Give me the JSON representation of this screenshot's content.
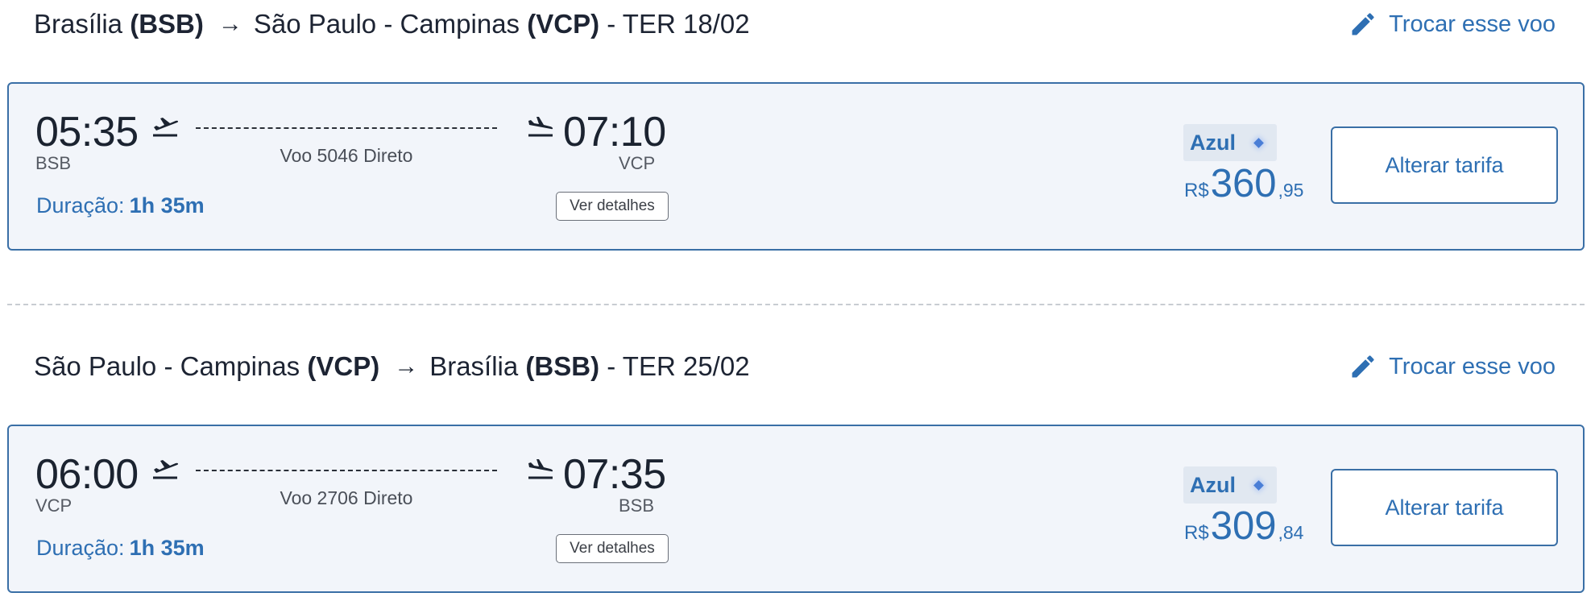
{
  "legs": [
    {
      "header": {
        "origin_city": "Brasília",
        "origin_code": "(BSB)",
        "dest_city": "São Paulo - Campinas",
        "dest_code": "(VCP)",
        "date": "- TER 18/02"
      },
      "change_label": "Trocar esse voo",
      "departure_time": "05:35",
      "departure_airport": "BSB",
      "arrival_time": "07:10",
      "arrival_airport": "VCP",
      "flight_info": "Voo 5046 Direto",
      "duration_label": "Duração:",
      "duration_value": "1h 35m",
      "details_label": "Ver detalhes",
      "airline": "Azul",
      "price_currency": "R$",
      "price_integer": "360",
      "price_decimal": ",95",
      "fare_button": "Alterar tarifa"
    },
    {
      "header": {
        "origin_city": "São Paulo - Campinas",
        "origin_code": "(VCP)",
        "dest_city": "Brasília",
        "dest_code": "(BSB)",
        "date": "- TER 25/02"
      },
      "change_label": "Trocar esse voo",
      "departure_time": "06:00",
      "departure_airport": "VCP",
      "arrival_time": "07:35",
      "arrival_airport": "BSB",
      "flight_info": "Voo 2706 Direto",
      "duration_label": "Duração:",
      "duration_value": "1h 35m",
      "details_label": "Ver detalhes",
      "airline": "Azul",
      "price_currency": "R$",
      "price_integer": "309",
      "price_decimal": ",84",
      "fare_button": "Alterar tarifa"
    }
  ],
  "colors": {
    "accent": "#2e6fb3",
    "card_border": "#3a6fa6",
    "card_background": "#f2f5fa"
  },
  "icons": [
    "pencil-icon",
    "arrow-right-icon",
    "takeoff-icon",
    "landing-icon",
    "diamond-icon"
  ]
}
